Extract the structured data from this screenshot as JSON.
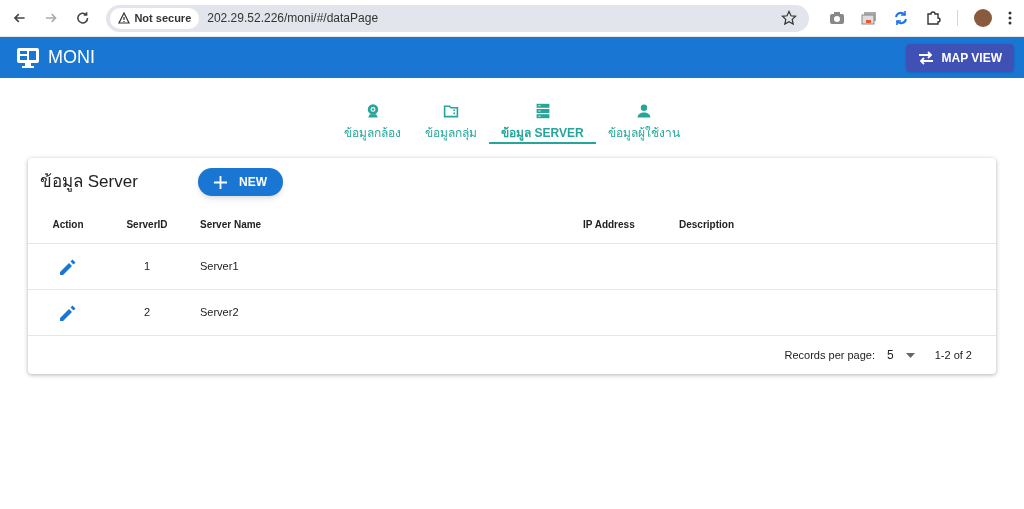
{
  "browser": {
    "security_label": "Not secure",
    "url": "202.29.52.226/moni/#/dataPage"
  },
  "app_bar": {
    "title": "MONI",
    "button": "MAP VIEW"
  },
  "tabs": [
    {
      "label": "ข้อมูลกล้อง",
      "kind": "camera",
      "selected": false
    },
    {
      "label": "ข้อมูลกลุ่ม",
      "kind": "folder",
      "selected": false
    },
    {
      "label": "ข้อมูล SERVER",
      "kind": "server",
      "selected": true
    },
    {
      "label": "ข้อมูลผู้ใช้งาน",
      "kind": "person",
      "selected": false
    }
  ],
  "card": {
    "title": "ข้อมูล Server",
    "new_button": "NEW",
    "table": {
      "columns": [
        "Action",
        "ServerID",
        "Server Name",
        "IP Address",
        "Description"
      ],
      "rows": [
        {
          "server_id": "1",
          "server_name": "Server1"
        },
        {
          "server_id": "2",
          "server_name": "Server2"
        }
      ]
    },
    "footer": {
      "records_label": "Records per page:",
      "per_page": "5",
      "range": "1-2 of 2"
    }
  }
}
